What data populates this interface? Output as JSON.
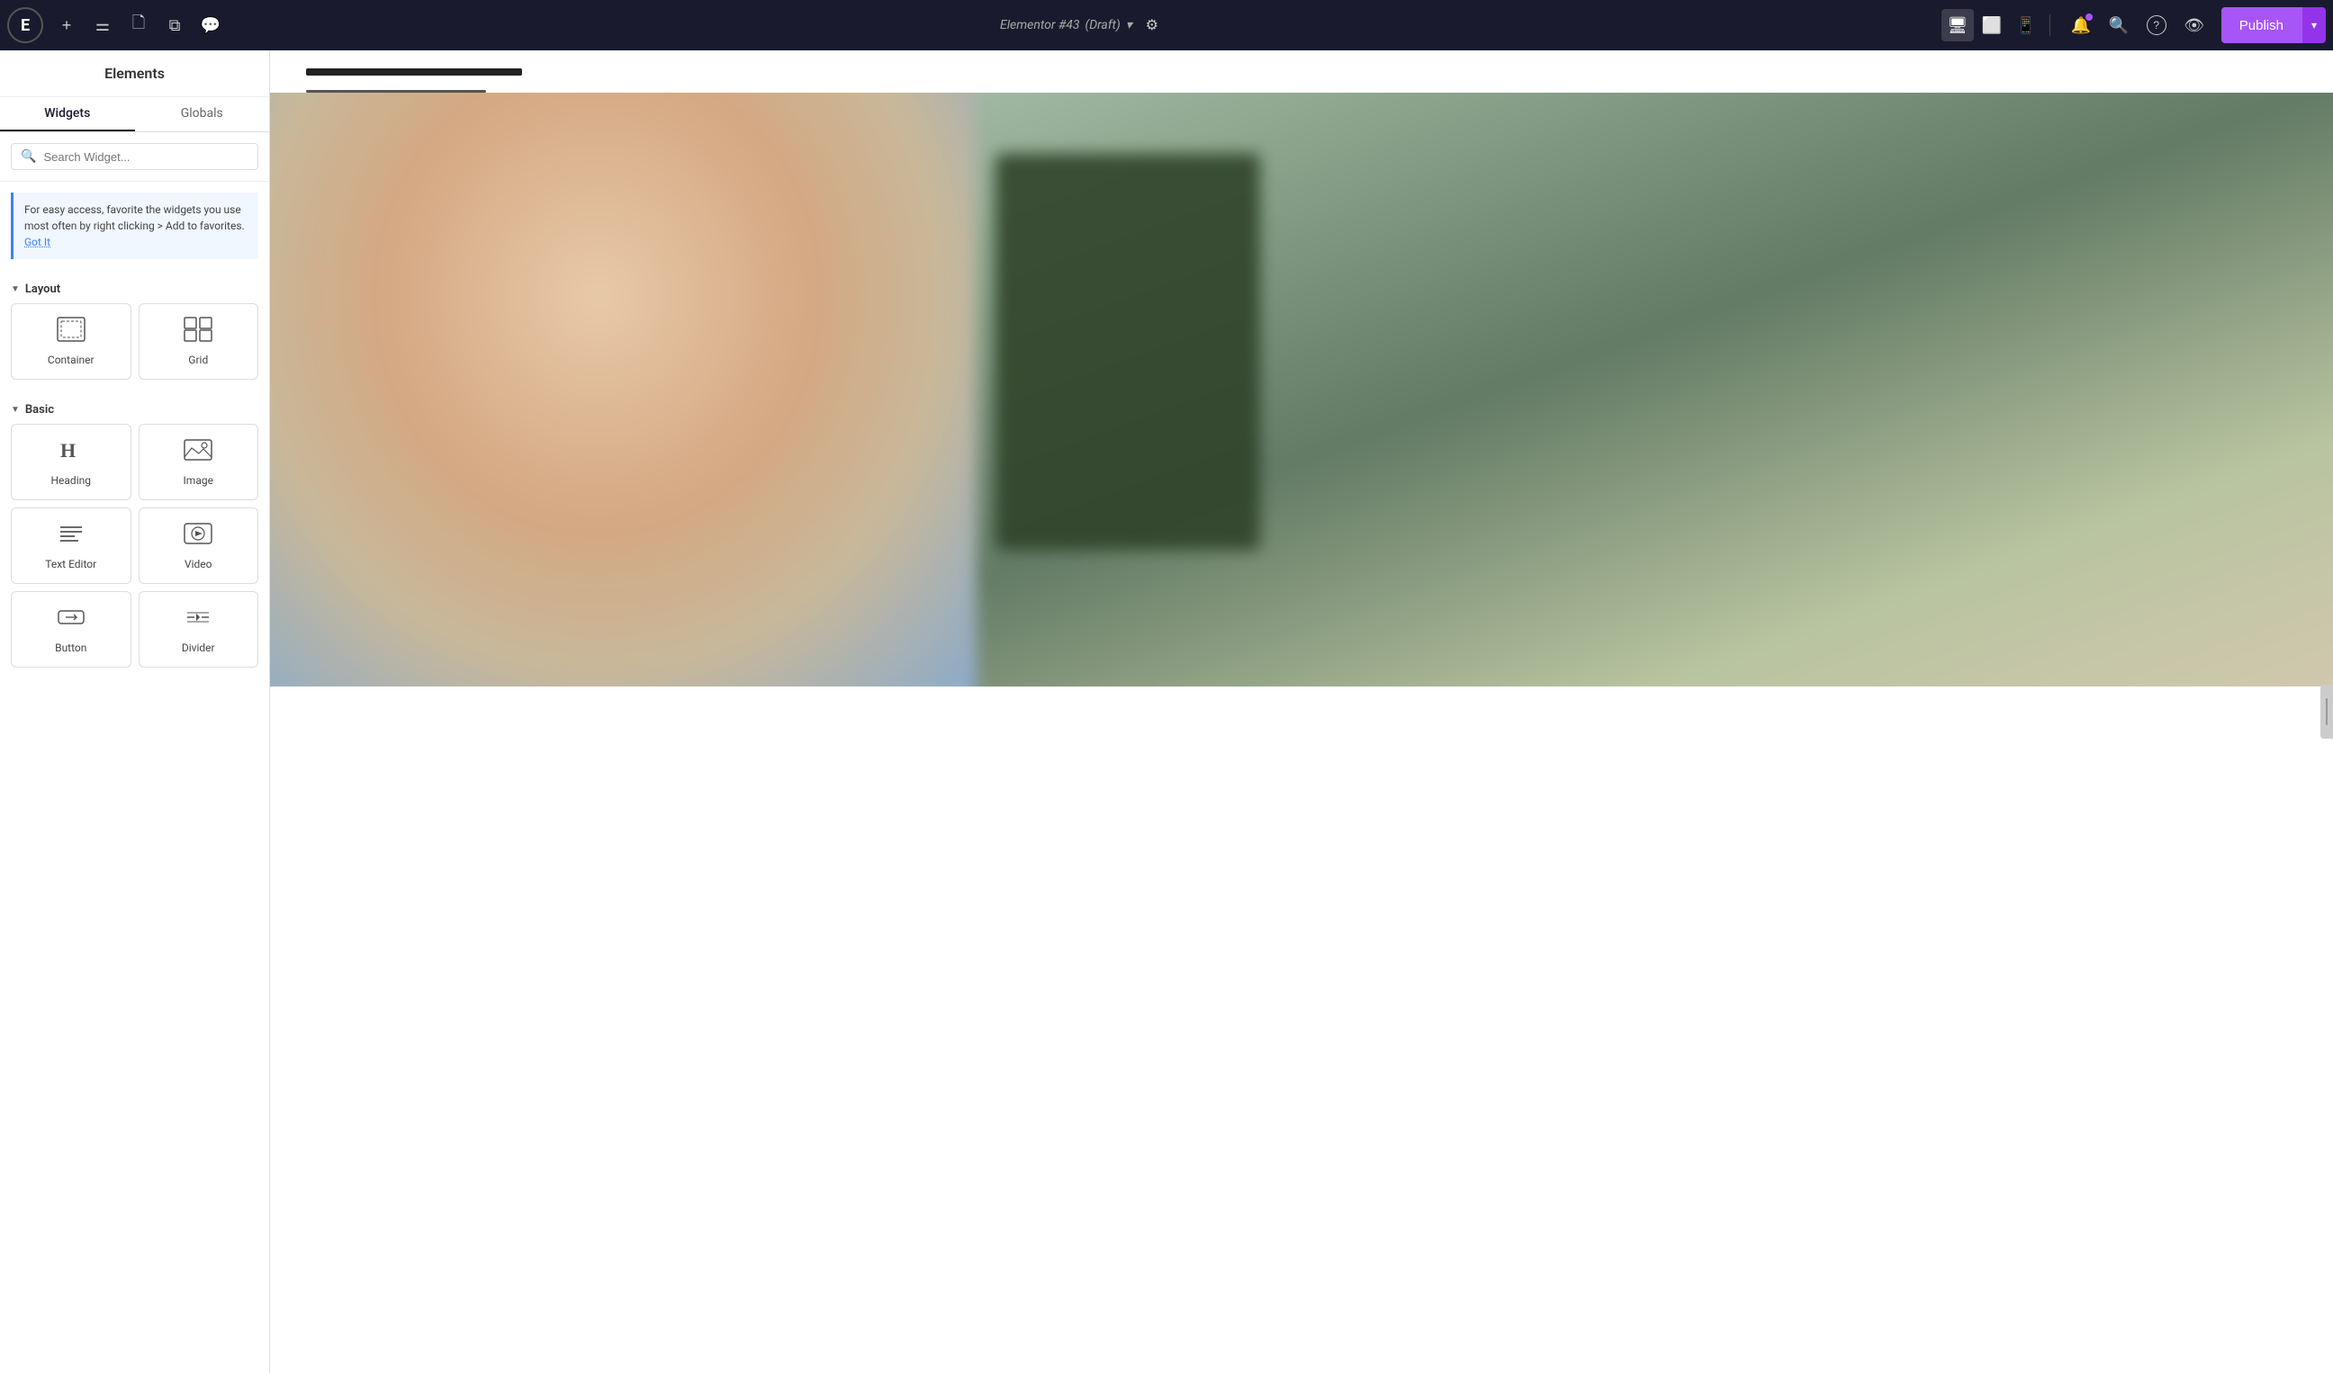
{
  "topbar": {
    "logo_text": "E",
    "title": "Elementor #43",
    "title_status": "(Draft)",
    "publish_label": "Publish",
    "add_icon": "+",
    "customize_icon": "⚙",
    "notification_icon": "🔔",
    "search_icon": "🔍",
    "help_icon": "?",
    "preview_icon": "👁",
    "desktop_icon": "🖥",
    "tablet_icon": "📱",
    "mobile_icon": "📱",
    "chevron_down": "▾"
  },
  "sidebar": {
    "header": "Elements",
    "tabs": [
      {
        "label": "Widgets",
        "active": true
      },
      {
        "label": "Globals",
        "active": false
      }
    ],
    "search_placeholder": "Search Widget...",
    "tip_text": "For easy access, favorite the widgets you use most often by right clicking > Add to favorites.",
    "tip_link": "Got It",
    "sections": [
      {
        "label": "Layout",
        "widgets": [
          {
            "label": "Container",
            "icon": "container"
          },
          {
            "label": "Grid",
            "icon": "grid"
          }
        ]
      },
      {
        "label": "Basic",
        "widgets": [
          {
            "label": "Heading",
            "icon": "heading"
          },
          {
            "label": "Image",
            "icon": "image"
          },
          {
            "label": "Text Editor",
            "icon": "text-editor"
          },
          {
            "label": "Video",
            "icon": "video"
          },
          {
            "label": "Button",
            "icon": "button"
          },
          {
            "label": "Divider",
            "icon": "divider"
          }
        ]
      }
    ]
  },
  "canvas": {
    "line_thick": "",
    "line_thin": ""
  },
  "colors": {
    "accent_purple": "#a855f7",
    "topbar_bg": "#1a1a2e",
    "active_tab_border": "#1a1a2e"
  }
}
